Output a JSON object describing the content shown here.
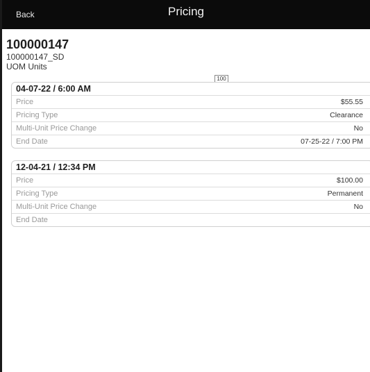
{
  "header_bar": {
    "back_label": "Back",
    "title": "Pricing"
  },
  "item": {
    "id": "100000147",
    "sku": "100000147_SD",
    "uom": "UOM Units"
  },
  "quantity_box": "100",
  "records": [
    {
      "date": "04-07-22 / 6:00 AM",
      "rows": [
        {
          "label": "Price",
          "value": "$55.55"
        },
        {
          "label": "Pricing Type",
          "value": "Clearance"
        },
        {
          "label": "Multi-Unit Price Change",
          "value": "No"
        },
        {
          "label": "End Date",
          "value": "07-25-22 / 7:00 PM"
        }
      ]
    },
    {
      "date": "12-04-21 / 12:34 PM",
      "rows": [
        {
          "label": "Price",
          "value": "$100.00"
        },
        {
          "label": "Pricing Type",
          "value": "Permanent"
        },
        {
          "label": "Multi-Unit Price Change",
          "value": "No"
        },
        {
          "label": "End Date",
          "value": ""
        }
      ]
    }
  ]
}
